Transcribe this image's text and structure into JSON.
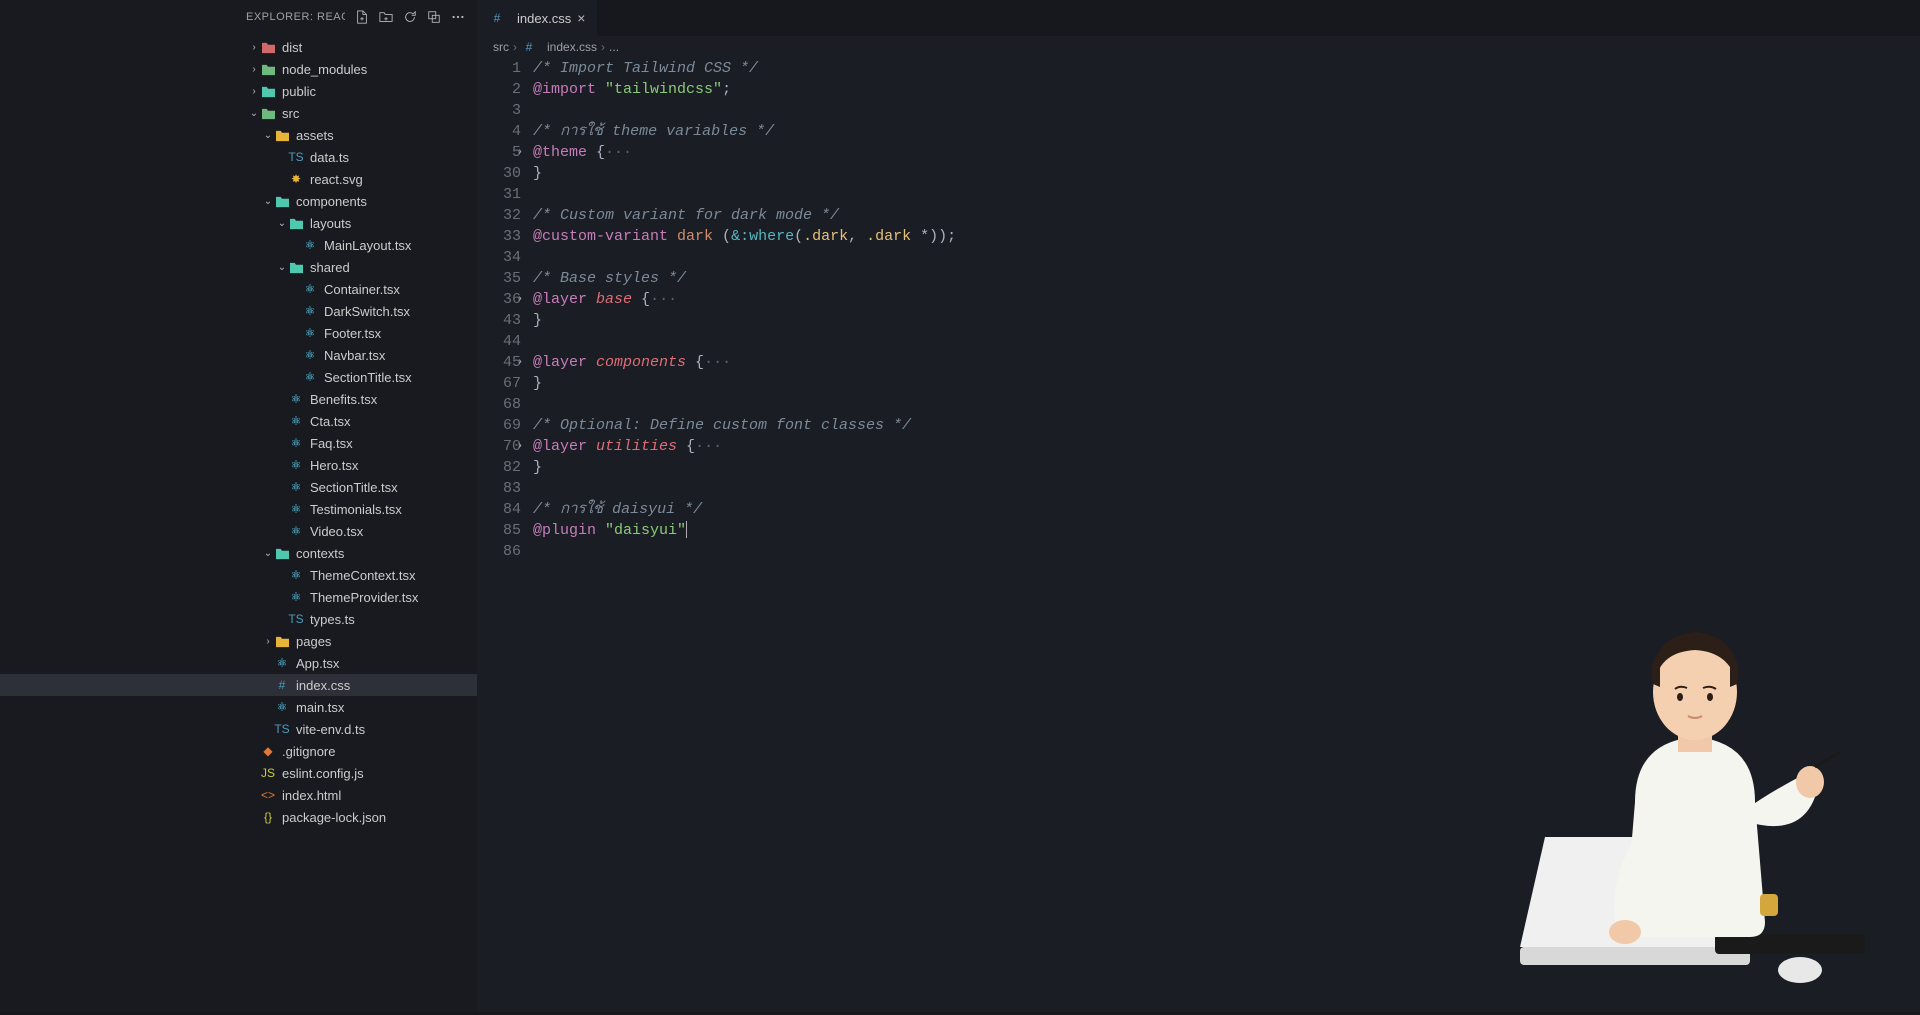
{
  "sidebar": {
    "title": "EXPLORER: REACT...",
    "actions": [
      "new-file",
      "new-folder",
      "refresh",
      "collapse",
      "more"
    ]
  },
  "tree": [
    {
      "depth": 0,
      "chev": "right",
      "icon": "folder-red",
      "label": "dist"
    },
    {
      "depth": 0,
      "chev": "right",
      "icon": "folder-green",
      "label": "node_modules"
    },
    {
      "depth": 0,
      "chev": "right",
      "icon": "folder-teal",
      "label": "public"
    },
    {
      "depth": 0,
      "chev": "down",
      "icon": "folder-green",
      "label": "src"
    },
    {
      "depth": 1,
      "chev": "down",
      "icon": "folder-yellow",
      "label": "assets"
    },
    {
      "depth": 2,
      "chev": "",
      "icon": "ts",
      "label": "data.ts"
    },
    {
      "depth": 2,
      "chev": "",
      "icon": "svg",
      "label": "react.svg"
    },
    {
      "depth": 1,
      "chev": "down",
      "icon": "folder-teal",
      "label": "components"
    },
    {
      "depth": 2,
      "chev": "down",
      "icon": "folder-teal",
      "label": "layouts"
    },
    {
      "depth": 3,
      "chev": "",
      "icon": "react",
      "label": "MainLayout.tsx"
    },
    {
      "depth": 2,
      "chev": "down",
      "icon": "folder-teal",
      "label": "shared"
    },
    {
      "depth": 3,
      "chev": "",
      "icon": "react",
      "label": "Container.tsx"
    },
    {
      "depth": 3,
      "chev": "",
      "icon": "react",
      "label": "DarkSwitch.tsx"
    },
    {
      "depth": 3,
      "chev": "",
      "icon": "react",
      "label": "Footer.tsx"
    },
    {
      "depth": 3,
      "chev": "",
      "icon": "react",
      "label": "Navbar.tsx"
    },
    {
      "depth": 3,
      "chev": "",
      "icon": "react",
      "label": "SectionTitle.tsx"
    },
    {
      "depth": 2,
      "chev": "",
      "icon": "react",
      "label": "Benefits.tsx"
    },
    {
      "depth": 2,
      "chev": "",
      "icon": "react",
      "label": "Cta.tsx"
    },
    {
      "depth": 2,
      "chev": "",
      "icon": "react",
      "label": "Faq.tsx"
    },
    {
      "depth": 2,
      "chev": "",
      "icon": "react",
      "label": "Hero.tsx"
    },
    {
      "depth": 2,
      "chev": "",
      "icon": "react",
      "label": "SectionTitle.tsx"
    },
    {
      "depth": 2,
      "chev": "",
      "icon": "react",
      "label": "Testimonials.tsx"
    },
    {
      "depth": 2,
      "chev": "",
      "icon": "react",
      "label": "Video.tsx"
    },
    {
      "depth": 1,
      "chev": "down",
      "icon": "folder-teal",
      "label": "contexts"
    },
    {
      "depth": 2,
      "chev": "",
      "icon": "react",
      "label": "ThemeContext.tsx"
    },
    {
      "depth": 2,
      "chev": "",
      "icon": "react",
      "label": "ThemeProvider.tsx"
    },
    {
      "depth": 2,
      "chev": "",
      "icon": "ts",
      "label": "types.ts"
    },
    {
      "depth": 1,
      "chev": "right",
      "icon": "folder-yellow",
      "label": "pages"
    },
    {
      "depth": 1,
      "chev": "",
      "icon": "react",
      "label": "App.tsx"
    },
    {
      "depth": 1,
      "chev": "",
      "icon": "css",
      "label": "index.css",
      "selected": true
    },
    {
      "depth": 1,
      "chev": "",
      "icon": "react",
      "label": "main.tsx"
    },
    {
      "depth": 1,
      "chev": "",
      "icon": "ts",
      "label": "vite-env.d.ts"
    },
    {
      "depth": 0,
      "chev": "",
      "icon": "git",
      "label": ".gitignore"
    },
    {
      "depth": 0,
      "chev": "",
      "icon": "js",
      "label": "eslint.config.js"
    },
    {
      "depth": 0,
      "chev": "",
      "icon": "html",
      "label": "index.html"
    },
    {
      "depth": 0,
      "chev": "",
      "icon": "json",
      "label": "package-lock.json"
    }
  ],
  "tab": {
    "icon": "css",
    "label": "index.css"
  },
  "breadcrumb": {
    "parts": [
      "src",
      "index.css",
      "..."
    ],
    "icon": "css"
  },
  "lineNumbers": [
    "1",
    "2",
    "3",
    "4",
    "5",
    "30",
    "31",
    "32",
    "33",
    "34",
    "35",
    "36",
    "43",
    "44",
    "45",
    "67",
    "68",
    "69",
    "70",
    "82",
    "83",
    "84",
    "85",
    "86"
  ],
  "folds": {
    "4": true,
    "11": true,
    "14": true,
    "18": true
  },
  "code": [
    [
      {
        "t": "/* Import Tailwind CSS */",
        "c": "comment"
      }
    ],
    [
      {
        "t": "@import",
        "c": "atrule"
      },
      {
        "t": " ",
        "c": "punct"
      },
      {
        "t": "\"tailwindcss\"",
        "c": "string"
      },
      {
        "t": ";",
        "c": "punct"
      }
    ],
    [],
    [
      {
        "t": "/* การใช้ theme variables */",
        "c": "comment"
      }
    ],
    [
      {
        "t": "@theme",
        "c": "atrule"
      },
      {
        "t": " {",
        "c": "punct"
      },
      {
        "t": "···",
        "c": "fold"
      }
    ],
    [
      {
        "t": "}",
        "c": "punct"
      }
    ],
    [],
    [
      {
        "t": "/* Custom variant for dark mode */",
        "c": "comment"
      }
    ],
    [
      {
        "t": "@custom-variant",
        "c": "atrule"
      },
      {
        "t": " dark ",
        "c": "keyword"
      },
      {
        "t": "(",
        "c": "punct"
      },
      {
        "t": "&:where",
        "c": "func"
      },
      {
        "t": "(",
        "c": "punct"
      },
      {
        "t": ".dark",
        "c": "sel"
      },
      {
        "t": ", ",
        "c": "punct"
      },
      {
        "t": ".dark",
        "c": "sel"
      },
      {
        "t": " *",
        "c": "punct"
      },
      {
        "t": "))",
        "c": "punct"
      },
      {
        "t": ";",
        "c": "punct"
      }
    ],
    [],
    [
      {
        "t": "/* Base styles */",
        "c": "comment"
      }
    ],
    [
      {
        "t": "@layer",
        "c": "atrule"
      },
      {
        "t": " ",
        "c": "punct"
      },
      {
        "t": "base",
        "c": "ident"
      },
      {
        "t": " {",
        "c": "punct"
      },
      {
        "t": "···",
        "c": "fold"
      }
    ],
    [
      {
        "t": "}",
        "c": "punct"
      }
    ],
    [],
    [
      {
        "t": "@layer",
        "c": "atrule"
      },
      {
        "t": " ",
        "c": "punct"
      },
      {
        "t": "components",
        "c": "ident"
      },
      {
        "t": " {",
        "c": "punct"
      },
      {
        "t": "···",
        "c": "fold"
      }
    ],
    [
      {
        "t": "}",
        "c": "punct"
      }
    ],
    [],
    [
      {
        "t": "/* Optional: Define custom font classes */",
        "c": "comment"
      }
    ],
    [
      {
        "t": "@layer",
        "c": "atrule"
      },
      {
        "t": " ",
        "c": "punct"
      },
      {
        "t": "utilities",
        "c": "ident"
      },
      {
        "t": " {",
        "c": "punct"
      },
      {
        "t": "···",
        "c": "fold"
      }
    ],
    [
      {
        "t": "}",
        "c": "punct"
      }
    ],
    [],
    [
      {
        "t": "/* การใช้ daisyui */",
        "c": "comment"
      }
    ],
    [
      {
        "t": "@plugin",
        "c": "atrule"
      },
      {
        "t": " ",
        "c": "punct"
      },
      {
        "t": "\"daisyui\"",
        "c": "string"
      },
      {
        "cursor": true
      }
    ],
    []
  ]
}
